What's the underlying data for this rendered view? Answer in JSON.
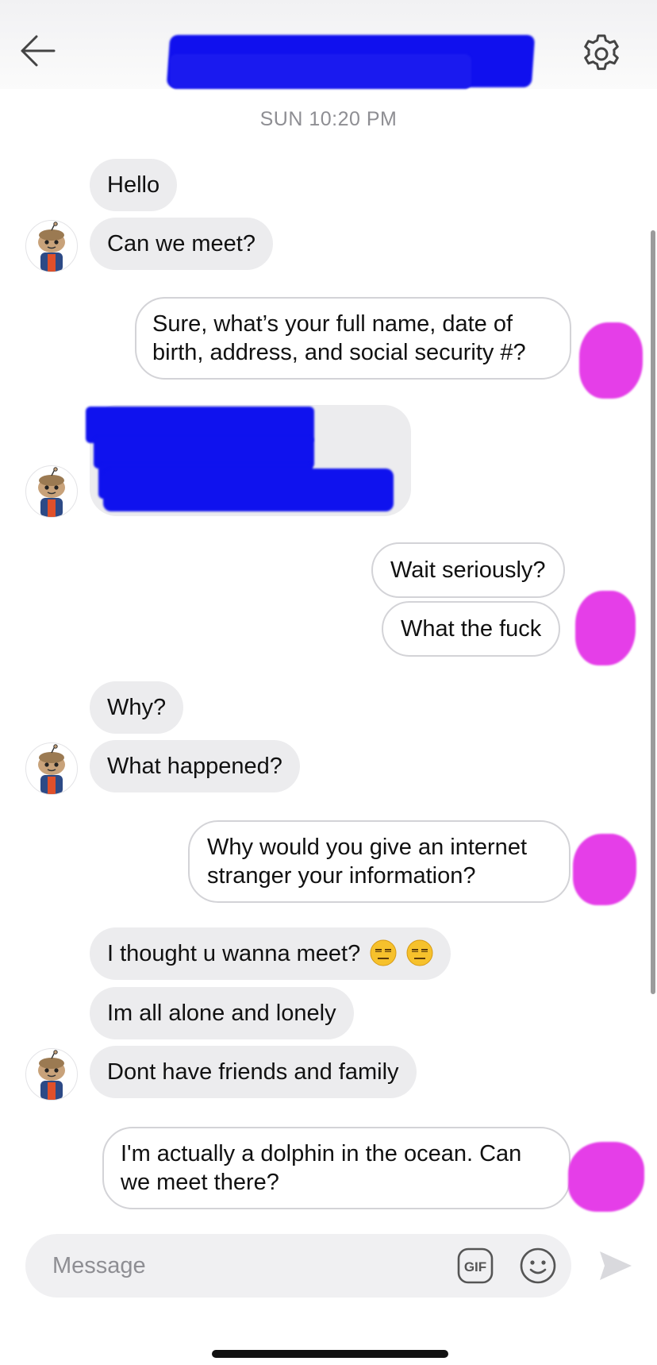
{
  "header": {
    "back_icon": "arrow-left-icon",
    "settings_icon": "gear-icon"
  },
  "timestamp": "SUN 10:20 PM",
  "messages": [
    {
      "text": "Hello",
      "from": "them"
    },
    {
      "text": "Can we meet?",
      "from": "them"
    },
    {
      "text": "Sure, what’s your full name, date of birth, address, and social security #?",
      "from": "me"
    },
    {
      "text": "Wait seriously?",
      "from": "me"
    },
    {
      "text": "What the fuck",
      "from": "me"
    },
    {
      "text": "Why?",
      "from": "them"
    },
    {
      "text": "What happened?",
      "from": "them"
    },
    {
      "text": "Why would you give an internet stranger your information?",
      "from": "me"
    },
    {
      "text": "I thought u wanna meet?",
      "emoji": "expressionless-face-emoji",
      "from": "them"
    },
    {
      "text": "Im all alone and lonely",
      "from": "them"
    },
    {
      "text": "Dont have friends and family",
      "from": "them"
    },
    {
      "text": "I'm actually a dolphin in the ocean. Can we meet there?",
      "from": "me"
    }
  ],
  "composer": {
    "placeholder": "Message",
    "gif_label": "GIF",
    "emoji_icon": "smiley-icon",
    "send_icon": "send-icon"
  },
  "colors": {
    "received_bubble": "#ececee",
    "sent_border": "#d3d3d7",
    "redaction_blue": "#0f12ee",
    "redaction_pink": "#e53ee8"
  }
}
